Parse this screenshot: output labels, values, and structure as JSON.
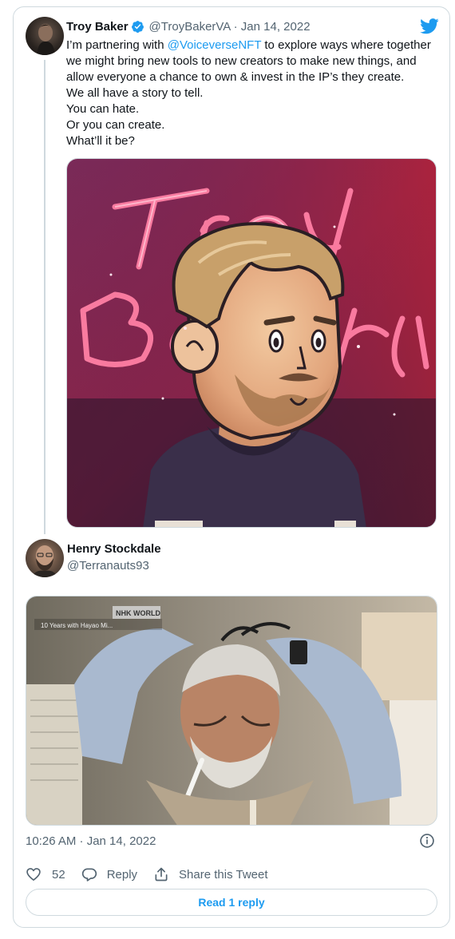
{
  "tweet": {
    "author_name": "Troy Baker",
    "handle_date": "@TroyBakerVA · Jan 14, 2022",
    "text": {
      "line1_before": "I’m partnering with ",
      "mention": "@VoiceverseNFT",
      "line1_after": " to explore ways where together",
      "line2": "we might bring new tools to new creators to make new things, and",
      "line3": "allow everyone a chance to own & invest in the IP’s they create.",
      "line4": "We all have a story to tell.",
      "line5": "You can hate.",
      "line6": "Or you can create.",
      "line7": "What’ll it be?"
    },
    "media_lettering": "Troy Baker"
  },
  "reply": {
    "author_name": "Henry Stockdale",
    "handle": "@Terranauts93",
    "media_overlay": {
      "channel": "NHK WORLD",
      "caption": "10 Years with Hayao Mi..."
    },
    "timestamp": "10:26 AM · Jan 14, 2022",
    "likes": "52",
    "reply_label": "Reply",
    "share_label": "Share this Tweet",
    "read_reply_label": "Read 1 reply"
  },
  "colors": {
    "accent": "#1d9bf0",
    "text": "#0f1419",
    "muted": "#536471",
    "border": "#cfd9de"
  },
  "icons": [
    "verified-badge-icon",
    "twitter-bird-icon",
    "info-icon",
    "heart-icon",
    "reply-bubble-icon",
    "share-icon"
  ]
}
